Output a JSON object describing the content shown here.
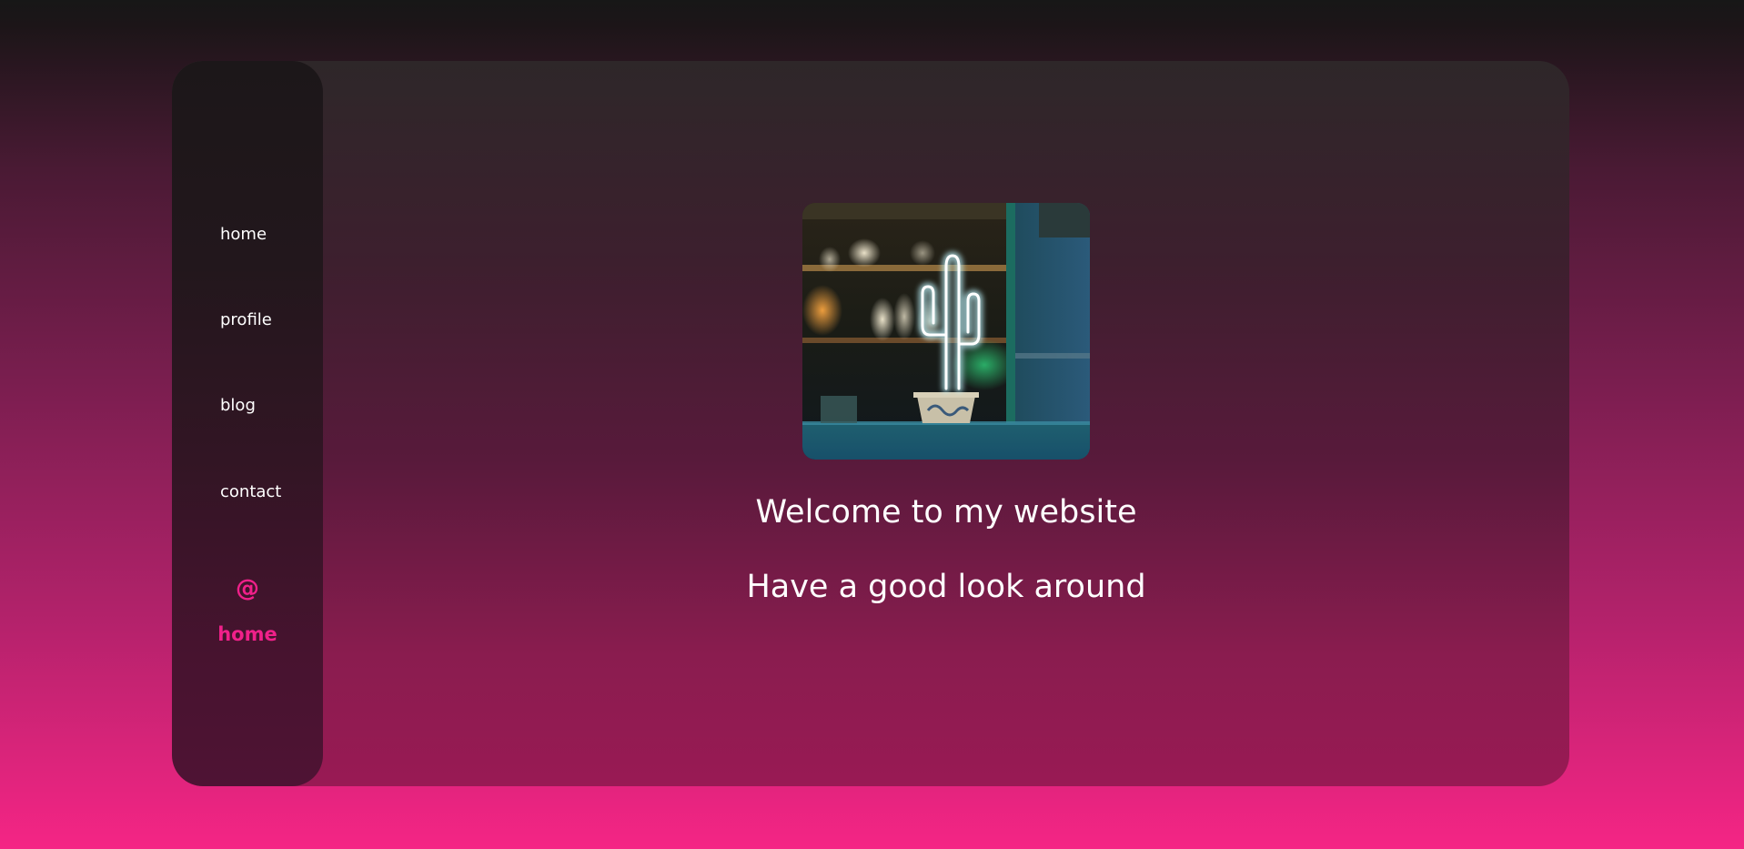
{
  "nav": {
    "items": [
      {
        "label": "home"
      },
      {
        "label": "profile"
      },
      {
        "label": "blog"
      },
      {
        "label": "contact"
      }
    ]
  },
  "brand": {
    "symbol": "@",
    "name": "home",
    "color": "#f0208a"
  },
  "hero": {
    "image_icon": "neon-cactus-photo",
    "welcome_text": "Welcome to my website",
    "subtitle_text": "Have a good look around"
  },
  "colors": {
    "background_bottom": "#f52585",
    "background_top": "#171717",
    "text": "#ffffff"
  }
}
